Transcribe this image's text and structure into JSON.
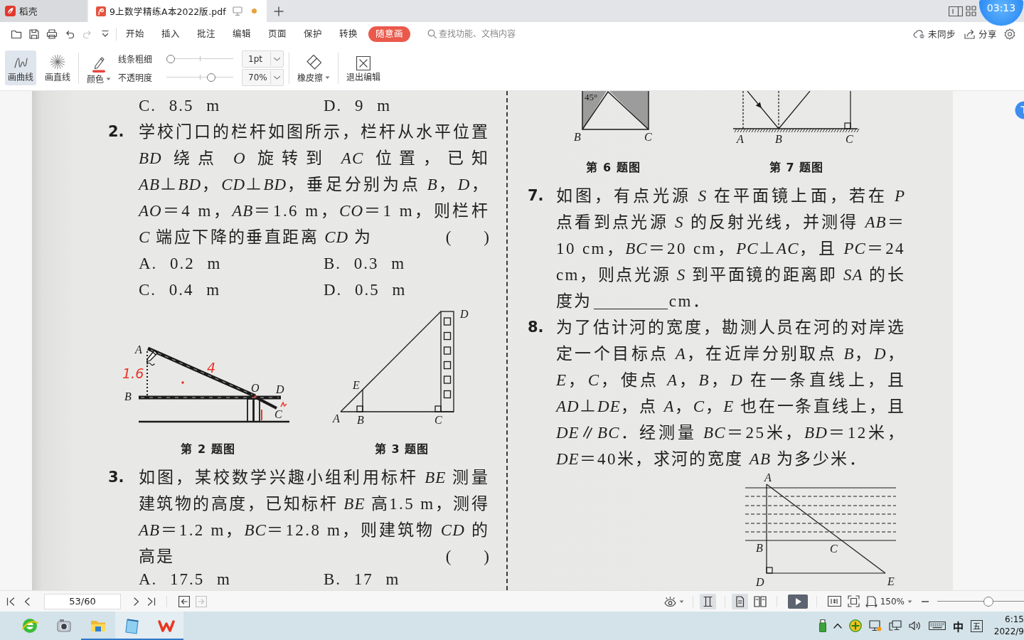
{
  "tab_bar": {
    "tabs": [
      {
        "kind": "home",
        "label": "稻壳",
        "selected": false,
        "unsaved": false
      },
      {
        "kind": "pdf",
        "label": "9上数学精练A本2022版.pdf",
        "selected": true,
        "unsaved": true
      }
    ]
  },
  "recording_timer": "03:13",
  "quick_toolbar": [
    {
      "kind": "open",
      "disabled": false
    },
    {
      "kind": "save",
      "disabled": false
    },
    {
      "kind": "print",
      "disabled": false
    },
    {
      "kind": "undo",
      "disabled": false
    },
    {
      "kind": "redo",
      "disabled": true
    },
    {
      "kind": "more",
      "disabled": false
    }
  ],
  "menu_tabs": [
    {
      "label": "开始",
      "selected": false
    },
    {
      "label": "插入",
      "selected": false
    },
    {
      "label": "批注",
      "selected": false
    },
    {
      "label": "编辑",
      "selected": false
    },
    {
      "label": "页面",
      "selected": false
    },
    {
      "label": "保护",
      "selected": false
    },
    {
      "label": "转换",
      "selected": false
    },
    {
      "label": "随意画",
      "selected": true
    }
  ],
  "search": {
    "placeholder": "查找功能、文档内容"
  },
  "account": {
    "sync": "未同步",
    "share": "分享"
  },
  "ribbon": {
    "draw_tools": [
      {
        "kind": "curve",
        "label": "画曲线",
        "selected": true
      },
      {
        "kind": "line",
        "label": "画直线",
        "selected": false
      }
    ],
    "color": {
      "label": "颜色"
    },
    "sliders": [
      {
        "label": "线条粗细",
        "level": 0,
        "value": "1pt"
      },
      {
        "label": "不透明度",
        "level": 0.7,
        "value": "70%"
      }
    ],
    "eraser": {
      "label": "橡皮擦"
    },
    "exit": {
      "label": "退出编辑"
    }
  },
  "document": {
    "columns": [
      {
        "blocks": [
          {
            "kind": "options",
            "items": [
              "C. 8.5 m",
              "D. 9 m"
            ]
          },
          {
            "kind": "problem",
            "number": "2.",
            "text": "学校门口的栏杆如图所示，栏杆从水平位置 *BD* 绕点 *O* 旋转到 *AC* 位置，已知 *AB*⊥*BD*，*CD*⊥*BD*，垂足分别为点 *B*，*D*，*AO*＝4 m，*AB*＝1.6 m，*CO*＝1 m，则栏杆 *C* 端应下降的垂直距离 *CD* 为",
            "bracket": "(　　)"
          },
          {
            "kind": "options",
            "items": [
              "A. 0.2 m",
              "B. 0.3 m"
            ]
          },
          {
            "kind": "options",
            "items": [
              "C. 0.4 m",
              "D. 0.5 m"
            ]
          },
          {
            "kind": "figures",
            "items": [
              {
                "kind": "gate",
                "labels": [
                  "A",
                  "B",
                  "O",
                  "D",
                  "C"
                ],
                "notes": [
                  "1.6",
                  "4"
                ],
                "caption": "第 2 题图"
              },
              {
                "kind": "building",
                "labels": [
                  "A",
                  "B",
                  "C",
                  "D",
                  "E"
                ],
                "caption": "第 3 题图"
              }
            ]
          },
          {
            "kind": "problem",
            "number": "3.",
            "text": "如图，某校数学兴趣小组利用标杆 *BE* 测量建筑物的高度，已知标杆 *BE* 高1.5 m，测得 *AB*＝1.2 m，*BC*＝12.8 m，则建筑物 *CD* 的高是",
            "bracket": "(　　)"
          },
          {
            "kind": "options",
            "items": [
              "A. 17.5 m",
              "B. 17 m"
            ]
          }
        ]
      },
      {
        "blocks": [
          {
            "kind": "figures",
            "items": [
              {
                "kind": "square",
                "labels": [
                  "45°",
                  "B",
                  "C"
                ],
                "caption": "第 6 题图"
              },
              {
                "kind": "mirror",
                "labels": [
                  "A",
                  "B",
                  "C"
                ],
                "caption": "第 7 题图"
              }
            ]
          },
          {
            "kind": "problem",
            "number": "7.",
            "text": "如图，有点光源 *S* 在平面镜上面，若在 *P* 点看到点光源 *S* 的反射光线，并测得 *AB*＝10 cm，*BC*＝20 cm，*PC*⊥*AC*，且 *PC*＝24 cm，则点光源 *S* 到平面镜的距离即 *SA* 的长度为",
            "blank": true,
            "text_after": "cm．"
          },
          {
            "kind": "problem",
            "number": "8.",
            "text": "为了估计河的宽度，勘测人员在河的对岸选定一个目标点 *A*，在近岸分别取点 *B*，*D*，*E*，*C*，使点 *A*，*B*，*D* 在一条直线上，且 *AD*⊥*DE*，点 *A*，*C*，*E* 也在一条直线上，且 *DE*∥*BC*．经测量 *BC*＝25米，*BD*＝12米，*DE*＝40米，求河的宽度 *AB* 为多少米．"
          },
          {
            "kind": "figures",
            "items": [
              {
                "kind": "river",
                "labels": [
                  "A",
                  "B",
                  "C",
                  "D",
                  "E"
                ]
              }
            ]
          }
        ]
      }
    ]
  },
  "status_bar": {
    "history": [
      {
        "kind": "back",
        "disabled": false
      },
      {
        "kind": "forward",
        "disabled": true
      }
    ],
    "page": "53/60",
    "view_modes": [
      {
        "kind": "continuous",
        "selected": true
      }
    ],
    "page_layouts": [
      {
        "kind": "single",
        "selected": true
      },
      {
        "kind": "double",
        "selected": false
      }
    ],
    "zoom": {
      "value": "150%",
      "level": 0.6
    }
  },
  "taskbar": {
    "apps": [
      {
        "kind": "browser",
        "running": false,
        "selected": false
      },
      {
        "kind": "camera",
        "running": false,
        "selected": false
      },
      {
        "kind": "folder",
        "running": true,
        "selected": false
      },
      {
        "kind": "notepad",
        "running": true,
        "selected": true
      },
      {
        "kind": "wps",
        "running": true,
        "selected": true
      }
    ],
    "tray": {
      "ime": "中",
      "input_mode": "五",
      "time": "6:15",
      "date": "2022/9"
    }
  }
}
